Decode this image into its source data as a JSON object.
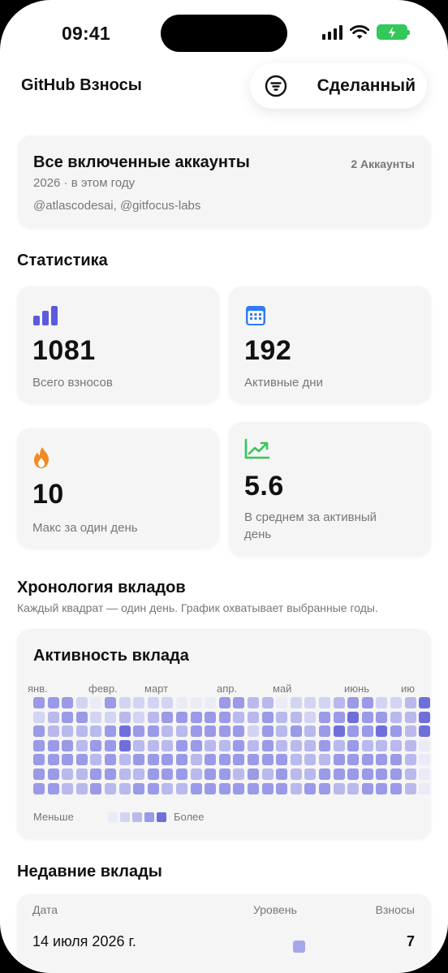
{
  "status_bar": {
    "time": "09:41"
  },
  "header": {
    "title": "GitHub Взносы",
    "done_label": "Сделанный"
  },
  "accounts": {
    "title": "Все включенные аккаунты",
    "badge": "2 Аккаунты",
    "subtitle": "2026 · в этом году",
    "users": "@atlascodesai, @gitfocus-labs"
  },
  "stats": {
    "section_title": "Статистика",
    "items": [
      {
        "icon": "bar-chart-icon",
        "value": "1081",
        "label": "Всего взносов",
        "color": "#5b5be0"
      },
      {
        "icon": "calendar-icon",
        "value": "192",
        "label": "Активные дни",
        "color": "#2f7bf6"
      },
      {
        "icon": "flame-icon",
        "value": "10",
        "label": "Макс за один день",
        "color": "#f08a24"
      },
      {
        "icon": "trend-up-icon",
        "value": "5.6",
        "label": "В среднем за активный день",
        "color": "#34c759"
      }
    ]
  },
  "timeline": {
    "section_title": "Хронология вкладов",
    "subtitle": "Каждый квадрат — один день. График охватывает выбранные годы.",
    "card_title": "Активность вклада",
    "months": [
      "янв.",
      "февр.",
      "март",
      "апр.",
      "май",
      "июнь",
      "ию"
    ],
    "legend_less": "Меньше",
    "legend_more": "Более",
    "colors": [
      "#ebebf7",
      "#d3d3f3",
      "#b9b9ee",
      "#9a9ae8",
      "#6f6fdc"
    ],
    "grid": [
      "3331031111000332201112331124",
      "1233112123333322322133433224",
      "3222234332233331323234334324",
      "3332334222332232322232322220",
      "3333232333323333332223333320",
      "3322332233323323232233333320",
      "3322322332233333332332233320"
    ]
  },
  "recent": {
    "section_title": "Недавние вклады",
    "columns": {
      "date": "Дата",
      "level": "Уровень",
      "count": "Взносы"
    },
    "rows": [
      {
        "date": "14 июля 2026 г.",
        "count": "7"
      }
    ]
  }
}
